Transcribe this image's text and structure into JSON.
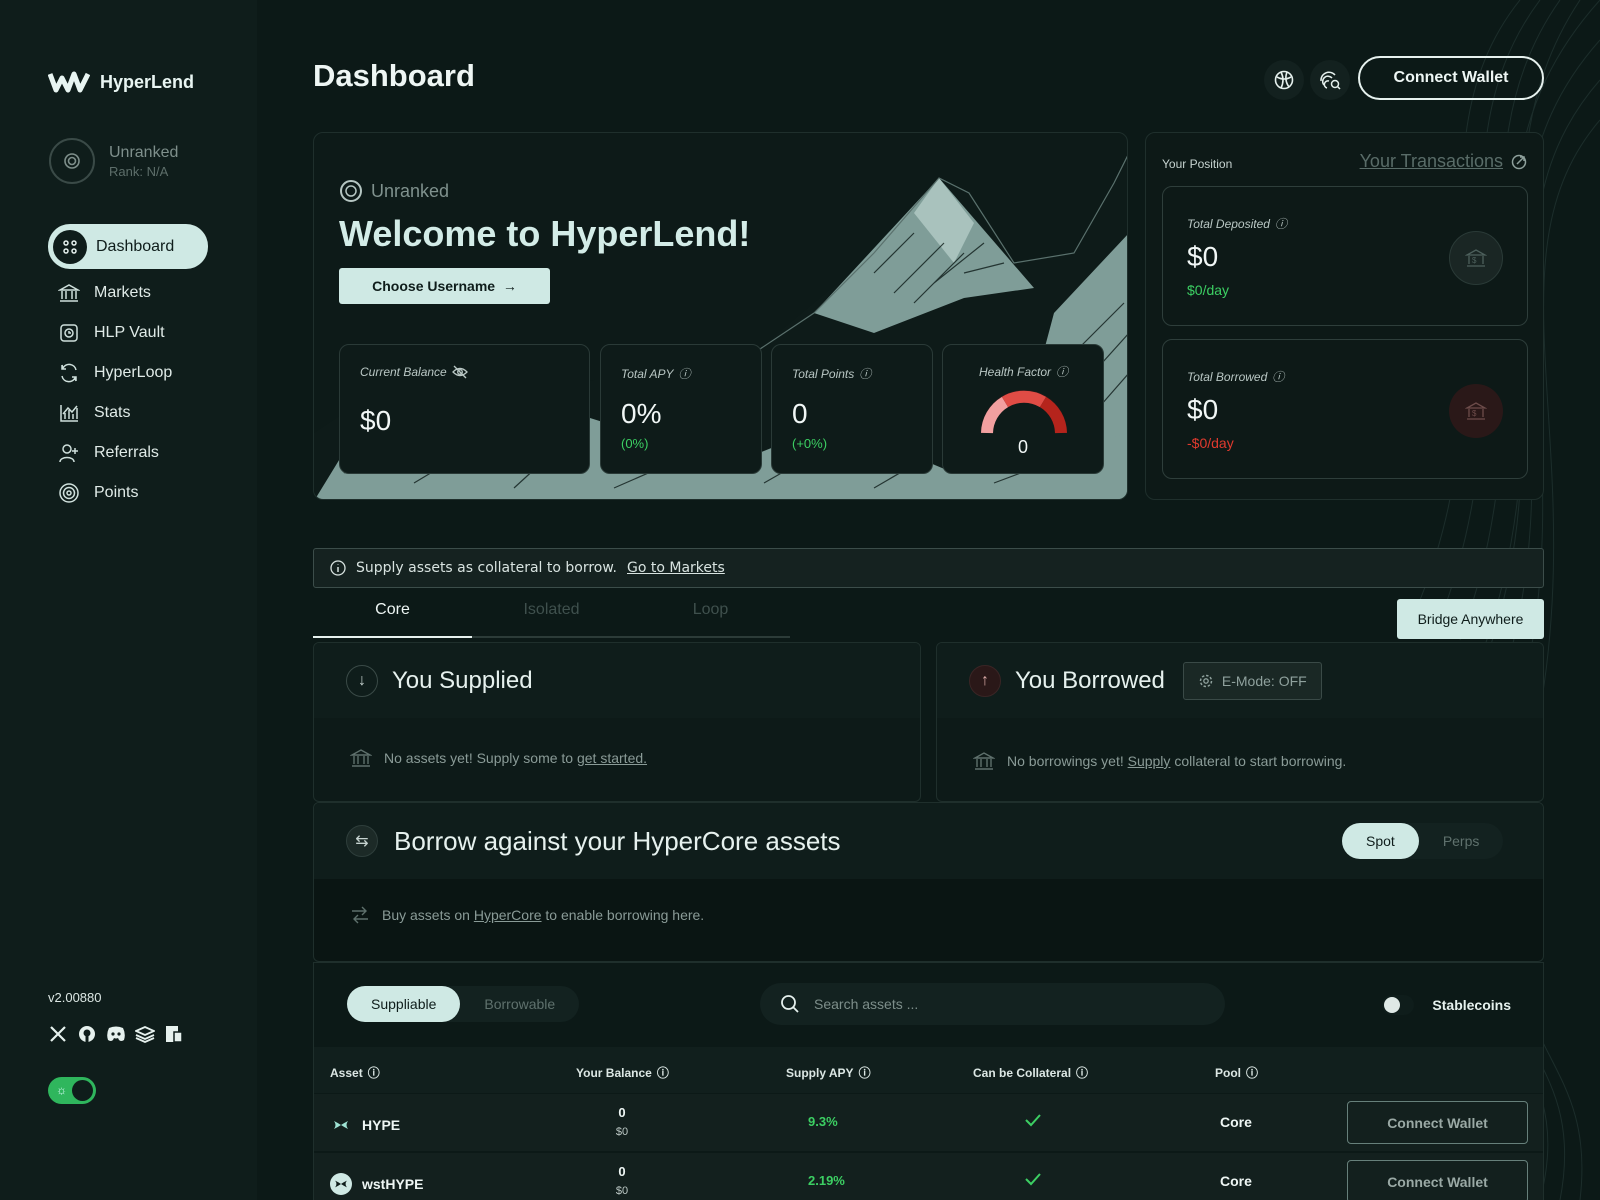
{
  "sidebar": {
    "brand": "HyperLend",
    "rank": {
      "title": "Unranked",
      "subtitle": "Rank: N/A"
    },
    "nav": [
      {
        "label": "Dashboard",
        "icon": "grid-icon",
        "active": true
      },
      {
        "label": "Markets",
        "icon": "bank-icon"
      },
      {
        "label": "HLP Vault",
        "icon": "vault-icon"
      },
      {
        "label": "HyperLoop",
        "icon": "loop-icon"
      },
      {
        "label": "Stats",
        "icon": "chart-icon"
      },
      {
        "label": "Referrals",
        "icon": "user-plus-icon"
      },
      {
        "label": "Points",
        "icon": "target-icon"
      }
    ],
    "version": "v2.00880",
    "theme_dark": true
  },
  "header": {
    "title": "Dashboard",
    "connect_label": "Connect Wallet"
  },
  "hero": {
    "rank": "Unranked",
    "title": "Welcome to HyperLend!",
    "cta": "Choose Username",
    "stats": {
      "balance": {
        "label": "Current Balance",
        "value": "$0"
      },
      "apy": {
        "label": "Total APY",
        "value": "0%",
        "sub": "(0%)"
      },
      "points": {
        "label": "Total Points",
        "value": "0",
        "sub": "(+0%)"
      },
      "health": {
        "label": "Health Factor",
        "value": "0"
      }
    }
  },
  "position": {
    "title": "Your Position",
    "link": "Your Transactions",
    "deposited": {
      "label": "Total Deposited",
      "value": "$0",
      "sub": "$0/day",
      "color": "#3ccf63"
    },
    "borrowed": {
      "label": "Total Borrowed",
      "value": "$0",
      "sub": "-$0/day",
      "color": "#e03a2e"
    }
  },
  "banner": {
    "text": "Supply assets as collateral to borrow.",
    "link": "Go to Markets"
  },
  "tabs": [
    "Core",
    "Isolated",
    "Loop"
  ],
  "bridge_label": "Bridge Anywhere",
  "supplied": {
    "title": "You Supplied",
    "empty_pre": "No assets yet! Supply some to",
    "empty_link": "get started."
  },
  "borrowed": {
    "title": "You Borrowed",
    "emode": "E-Mode: OFF",
    "empty_pre": "No borrowings yet!",
    "empty_link": "Supply",
    "empty_post": "collateral to start borrowing."
  },
  "hypercore": {
    "title": "Borrow against your HyperCore assets",
    "seg": [
      "Spot",
      "Perps"
    ],
    "body_pre": "Buy assets on",
    "body_link": "HyperCore",
    "body_post": "to enable borrowing here."
  },
  "assets": {
    "seg": [
      "Suppliable",
      "Borrowable"
    ],
    "search_placeholder": "Search assets ...",
    "stable_label": "Stablecoins",
    "columns": [
      "Asset",
      "Your Balance",
      "Supply APY",
      "Can be Collateral",
      "Pool"
    ],
    "rows": [
      {
        "asset": "HYPE",
        "balance": "0",
        "balance_usd": "$0",
        "apy": "9.3%",
        "collateral": true,
        "pool": "Core",
        "action": "Connect Wallet"
      },
      {
        "asset": "wstHYPE",
        "balance": "0",
        "balance_usd": "$0",
        "apy": "2.19%",
        "collateral": true,
        "pool": "Core",
        "action": "Connect Wallet"
      }
    ]
  }
}
